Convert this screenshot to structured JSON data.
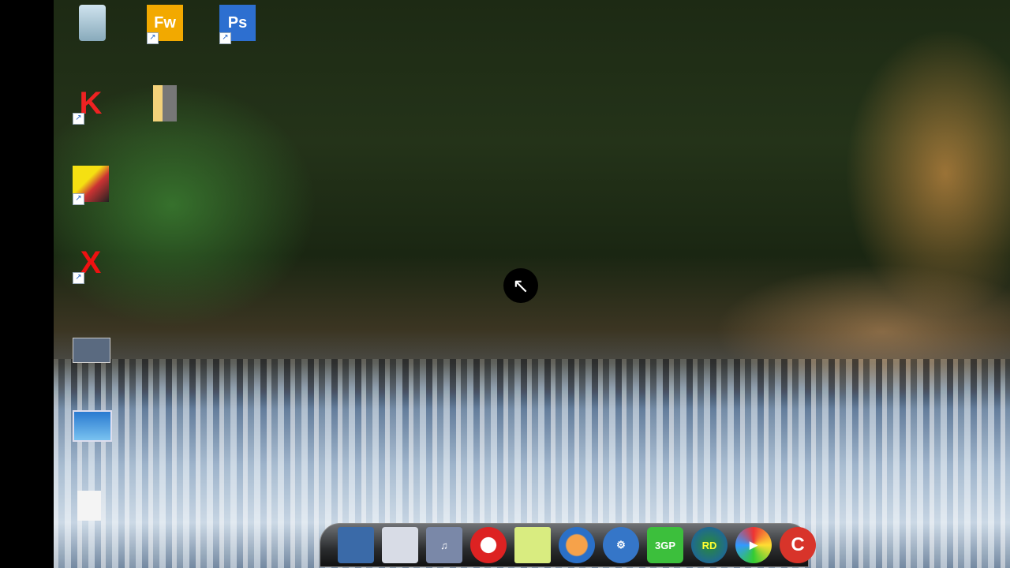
{
  "desktop_icons": [
    {
      "name": "recycle-bin",
      "glyph": ""
    },
    {
      "name": "fireworks",
      "glyph": "Fw"
    },
    {
      "name": "photoshop",
      "glyph": "Ps"
    },
    {
      "name": "kaspersky",
      "glyph": "K"
    },
    {
      "name": "folder",
      "glyph": ""
    },
    {
      "name": "game",
      "glyph": ""
    },
    {
      "name": "video-tool",
      "glyph": "X"
    }
  ],
  "dock_items": [
    {
      "name": "monitor",
      "glyph": ""
    },
    {
      "name": "documents-folder",
      "glyph": ""
    },
    {
      "name": "music-folder",
      "glyph": "♫"
    },
    {
      "name": "nero",
      "glyph": ""
    },
    {
      "name": "sticky-notes",
      "glyph": ""
    },
    {
      "name": "monkey-app",
      "glyph": ""
    },
    {
      "name": "settings-app",
      "glyph": "⚙"
    },
    {
      "name": "3gp-converter",
      "glyph": "3GP"
    },
    {
      "name": "rd-app",
      "glyph": "RD"
    },
    {
      "name": "media-player",
      "glyph": "▶"
    },
    {
      "name": "ccleaner",
      "glyph": "C"
    }
  ]
}
